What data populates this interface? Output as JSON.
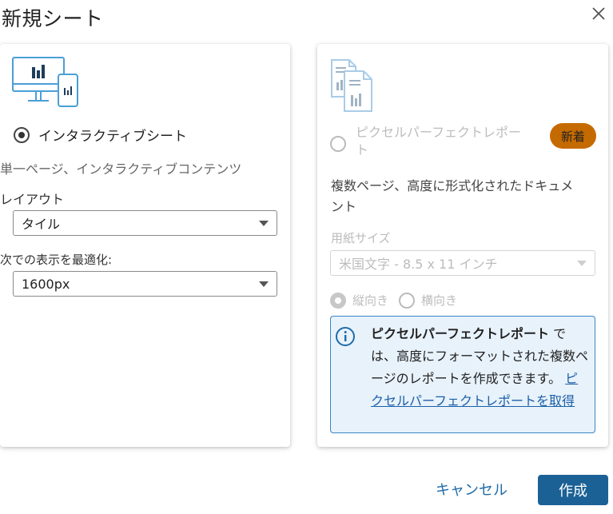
{
  "dialog": {
    "title": "新規シート",
    "close_icon": "close-icon"
  },
  "interactive_sheet": {
    "icon": "dashboard-monitor-icon",
    "radio_selected": true,
    "label": "インタラクティブシート",
    "description": "単一ページ、インタラクティブコンテンツ",
    "layout_label": "レイアウト",
    "layout_value": "タイル",
    "optimize_label": "次での表示を最適化:",
    "optimize_value": "1600px"
  },
  "pixel_perfect": {
    "icon": "paginated-document-icon",
    "radio_selected": false,
    "label_line1": "ピクセルパーフェクトレポー",
    "label_line2": "ト",
    "badge": "新着",
    "description_line1": "複数ページ、高度に形式化されたドキュメ",
    "description_line2": "ント",
    "paper_label": "用紙サイズ",
    "paper_value": "米国文字 - 8.5 x 11 インチ",
    "portrait_label": "縦向き",
    "landscape_label": "横向き",
    "info": {
      "bold": "ピクセルパーフェクトレポート",
      "text": " では、高度にフォーマットされた複数ページのレポートを作成できます。 ",
      "link": "ピクセルパーフェクトレポートを取得"
    }
  },
  "buttons": {
    "cancel": "キャンセル",
    "create": "作成"
  },
  "colors": {
    "primary": "#1b6196",
    "badge": "#c56a00",
    "info_border": "#3b83c4",
    "info_bg": "#e8f2fb",
    "link": "#1b5fa8"
  }
}
